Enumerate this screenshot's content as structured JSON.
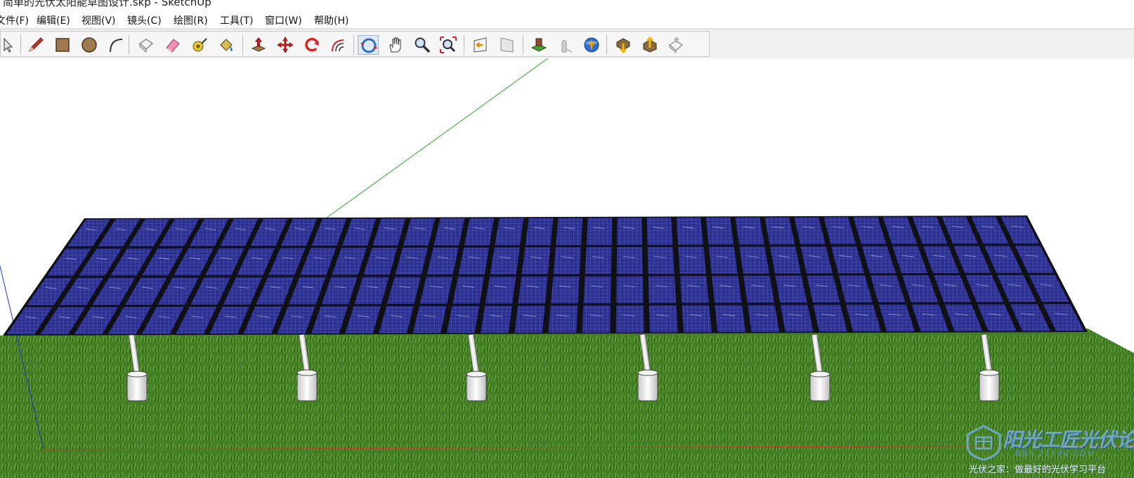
{
  "window": {
    "title": "简单的光伏太阳能草图设计.skp - SketchUp"
  },
  "menu": [
    {
      "label": "文件(F)"
    },
    {
      "label": "编辑(E)"
    },
    {
      "label": "视图(V)"
    },
    {
      "label": "镜头(C)"
    },
    {
      "label": "绘图(R)"
    },
    {
      "label": "工具(T)"
    },
    {
      "label": "窗口(W)"
    },
    {
      "label": "帮助(H)"
    }
  ],
  "toolbar": {
    "tools": [
      {
        "icon": "select-arrow-icon"
      },
      {
        "icon": "pencil-line-icon"
      },
      {
        "icon": "rectangle-icon"
      },
      {
        "icon": "circle-icon"
      },
      {
        "icon": "arc-icon"
      },
      {
        "icon": "make-component-icon"
      },
      {
        "icon": "eraser-icon"
      },
      {
        "icon": "tape-measure-icon"
      },
      {
        "icon": "paint-bucket-icon"
      },
      {
        "icon": "push-pull-icon"
      },
      {
        "icon": "move-icon"
      },
      {
        "icon": "rotate-icon"
      },
      {
        "icon": "offset-icon"
      },
      {
        "icon": "orbit-icon"
      },
      {
        "icon": "pan-hand-icon"
      },
      {
        "icon": "zoom-icon"
      },
      {
        "icon": "zoom-extents-icon"
      },
      {
        "icon": "previous-view-icon"
      },
      {
        "icon": "next-view-icon"
      },
      {
        "icon": "add-location-icon"
      },
      {
        "icon": "toggle-terrain-icon"
      },
      {
        "icon": "google-earth-icon"
      },
      {
        "icon": "get-models-icon"
      },
      {
        "icon": "share-model-icon"
      },
      {
        "icon": "share-component-icon"
      }
    ],
    "active_tool": "orbit-icon"
  },
  "scene": {
    "sky_color": "#ffffff",
    "grass_color": "#3f7a22",
    "panel_color": "#2b2f8f",
    "panel_rows": 4,
    "panel_columns": 32,
    "post_count": 6,
    "axis_colors": {
      "green": "#2fa52f",
      "red": "#c0392b",
      "blue": "#2233bb"
    }
  },
  "watermark": {
    "title": "阳光工匠光伏论坛",
    "url": "BBS.21SPV.COM",
    "slogan": "光伏之家：做最好的光伏学习平台"
  }
}
